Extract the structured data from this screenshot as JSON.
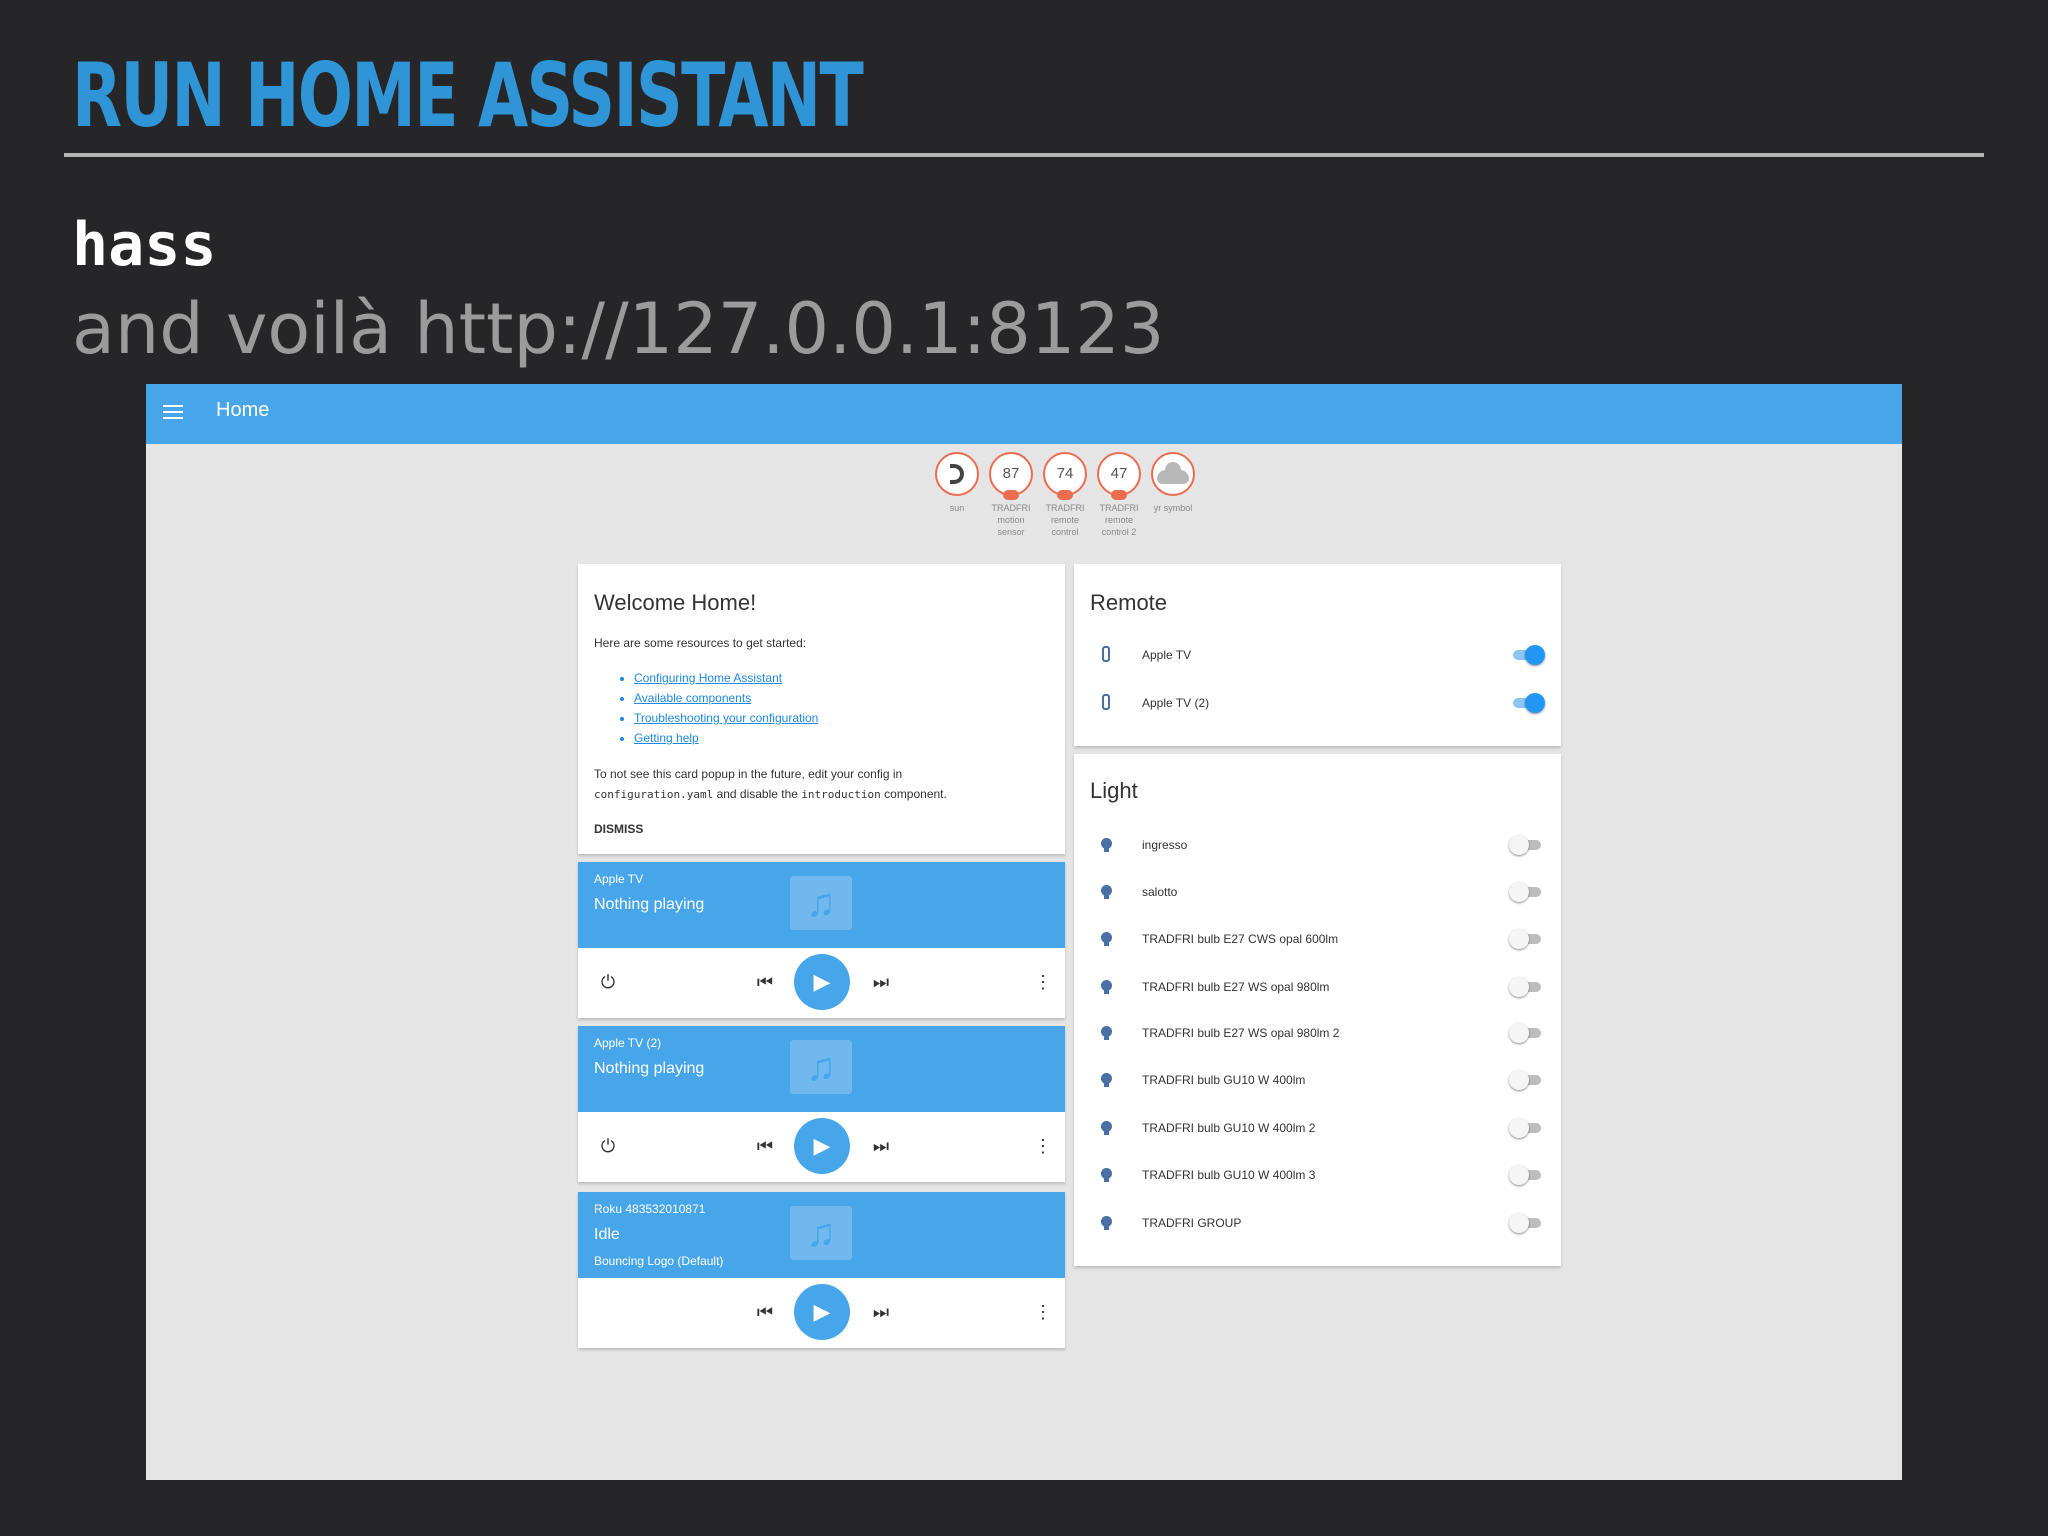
{
  "slide": {
    "title": "RUN HOME ASSISTANT",
    "command": "hass",
    "subtitle": "and voilà http://127.0.0.1:8123"
  },
  "app": {
    "header_title": "Home",
    "badges": [
      {
        "value": "",
        "label": "sun",
        "icon": "moon-icon"
      },
      {
        "value": "87",
        "label": "TRADFRI motion sensor",
        "icon": ""
      },
      {
        "value": "74",
        "label": "TRADFRI remote control",
        "icon": ""
      },
      {
        "value": "47",
        "label": "TRADFRI remote control 2",
        "icon": ""
      },
      {
        "value": "",
        "label": "yr symbol",
        "icon": "cloud-icon"
      }
    ],
    "welcome": {
      "title": "Welcome Home!",
      "intro": "Here are some resources to get started:",
      "links": [
        "Configuring Home Assistant",
        "Available components",
        "Troubleshooting your configuration",
        "Getting help"
      ],
      "note_before": "To not see this card popup in the future, edit your config in",
      "note_file": "configuration.yaml",
      "note_middle": "and disable the",
      "note_component": "introduction",
      "note_after": "component.",
      "dismiss": "DISMISS"
    },
    "media_players": [
      {
        "name": "Apple TV",
        "state": "Nothing playing",
        "extra": ""
      },
      {
        "name": "Apple TV (2)",
        "state": "Nothing playing",
        "extra": ""
      },
      {
        "name": "Roku 483532010871",
        "state": "Idle",
        "extra": "Bouncing Logo (Default)"
      }
    ],
    "remote": {
      "title": "Remote",
      "items": [
        {
          "label": "Apple TV",
          "on": true
        },
        {
          "label": "Apple TV (2)",
          "on": true
        }
      ]
    },
    "light": {
      "title": "Light",
      "items": [
        {
          "label": "ingresso",
          "on": false
        },
        {
          "label": "salotto",
          "on": false
        },
        {
          "label": "TRADFRI bulb E27 CWS opal 600lm",
          "on": false
        },
        {
          "label": "TRADFRI bulb E27 WS opal 980lm",
          "on": false
        },
        {
          "label": "TRADFRI bulb E27 WS opal 980lm 2",
          "on": false
        },
        {
          "label": "TRADFRI bulb GU10 W 400lm",
          "on": false
        },
        {
          "label": "TRADFRI bulb GU10 W 400lm 2",
          "on": false
        },
        {
          "label": "TRADFRI bulb GU10 W 400lm 3",
          "on": false
        },
        {
          "label": "TRADFRI GROUP",
          "on": false
        }
      ]
    },
    "colors": {
      "primary": "#47a6ea",
      "accent": "#2196f3",
      "badge": "#ec6c4f",
      "title_blue": "#2f95d6"
    }
  }
}
